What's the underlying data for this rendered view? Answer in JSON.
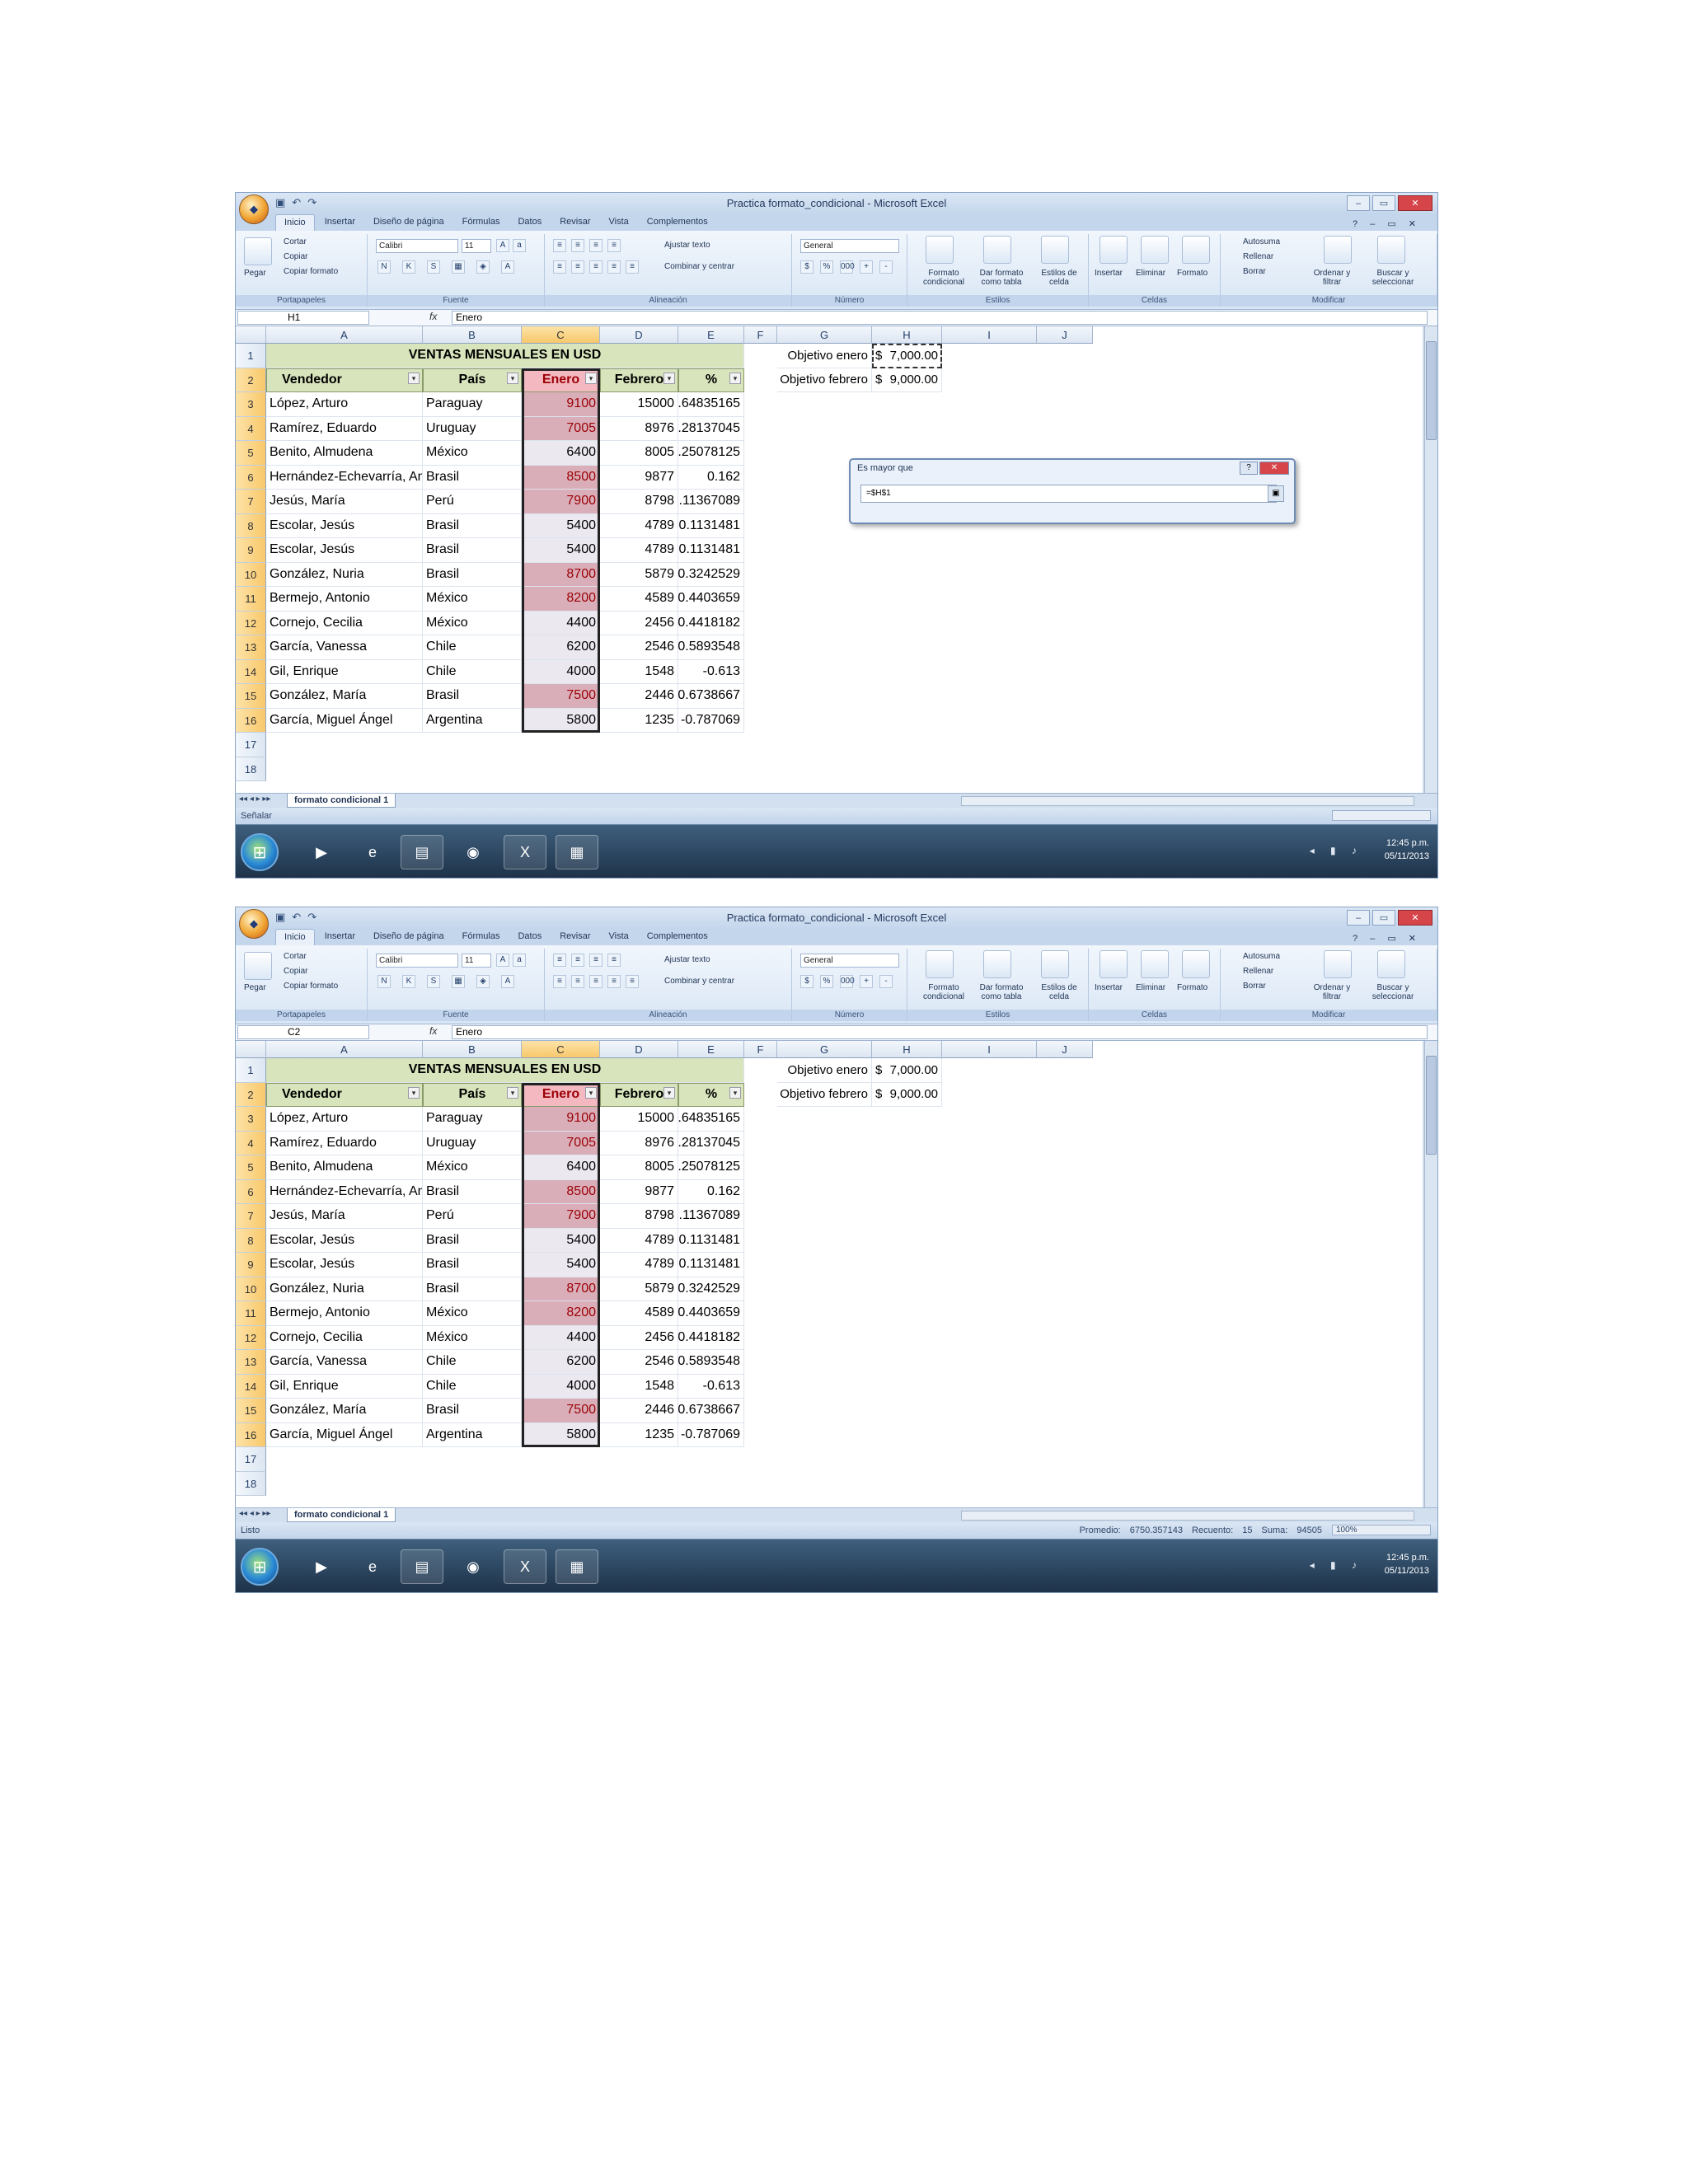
{
  "window_title": "Practica formato_condicional - Microsoft Excel",
  "ribbon_tabs": [
    "Inicio",
    "Insertar",
    "Diseño de página",
    "Fórmulas",
    "Datos",
    "Revisar",
    "Vista",
    "Complementos"
  ],
  "ribbon": {
    "paste": "Pegar",
    "cut": "Cortar",
    "copy": "Copiar",
    "format_painter": "Copiar formato",
    "group_clipboard": "Portapapeles",
    "font_name": "Calibri",
    "font_size": "11",
    "group_font": "Fuente",
    "wrap_text": "Ajustar texto",
    "merge_center": "Combinar y centrar",
    "group_alignment": "Alineación",
    "number_format": "General",
    "group_number": "Número",
    "conditional_format": "Formato condicional",
    "format_as_table": "Dar formato como tabla",
    "cell_styles": "Estilos de celda",
    "group_styles": "Estilos",
    "insert": "Insertar",
    "delete": "Eliminar",
    "format": "Formato",
    "group_cells": "Celdas",
    "autosum": "Autosuma",
    "fill": "Rellenar",
    "clear": "Borrar",
    "sort_filter": "Ordenar y filtrar",
    "find_select": "Buscar y seleccionar",
    "group_editing": "Modificar"
  },
  "columns": [
    "A",
    "B",
    "C",
    "D",
    "E",
    "F",
    "G",
    "H",
    "I",
    "J"
  ],
  "rows": [
    "1",
    "2",
    "3",
    "4",
    "5",
    "6",
    "7",
    "8",
    "9",
    "10",
    "11",
    "12",
    "13",
    "14",
    "15",
    "16",
    "17",
    "18"
  ],
  "table": {
    "title": "VENTAS MENSUALES EN USD",
    "headers": [
      "Vendedor",
      "País",
      "Enero",
      "Febrero",
      "%"
    ],
    "rows": [
      [
        "López, Arturo",
        "Paraguay",
        "9100",
        "15000",
        "0.64835165"
      ],
      [
        "Ramírez, Eduardo",
        "Uruguay",
        "7005",
        "8976",
        "0.28137045"
      ],
      [
        "Benito, Almudena",
        "México",
        "6400",
        "8005",
        "0.25078125"
      ],
      [
        "Hernández-Echevarría, Amaya",
        "Brasil",
        "8500",
        "9877",
        "0.162"
      ],
      [
        "Jesús, María",
        "Perú",
        "7900",
        "8798",
        "0.11367089"
      ],
      [
        "Escolar, Jesús",
        "Brasil",
        "5400",
        "4789",
        "-0.1131481"
      ],
      [
        "Escolar, Jesús",
        "Brasil",
        "5400",
        "4789",
        "-0.1131481"
      ],
      [
        "González, Nuria",
        "Brasil",
        "8700",
        "5879",
        "-0.3242529"
      ],
      [
        "Bermejo, Antonio",
        "México",
        "8200",
        "4589",
        "-0.4403659"
      ],
      [
        "Cornejo, Cecilia",
        "México",
        "4400",
        "2456",
        "-0.4418182"
      ],
      [
        "García, Vanessa",
        "Chile",
        "6200",
        "2546",
        "-0.5893548"
      ],
      [
        "Gil, Enrique",
        "Chile",
        "4000",
        "1548",
        "-0.613"
      ],
      [
        "González, María",
        "Brasil",
        "7500",
        "2446",
        "-0.6738667"
      ],
      [
        "García, Miguel Ángel",
        "Argentina",
        "5800",
        "1235",
        "-0.787069"
      ]
    ],
    "highlighted": [
      true,
      true,
      false,
      true,
      true,
      false,
      false,
      true,
      true,
      false,
      false,
      false,
      true,
      false
    ]
  },
  "objectives": {
    "enero_label": "Objetivo enero",
    "enero_currency": "$",
    "enero_value": "7,000.00",
    "febrero_label": "Objetivo febrero",
    "febrero_currency": "$",
    "febrero_value": "9,000.00"
  },
  "sheet_tab": "formato condicional 1",
  "colors": {
    "header_fill": "#d8e4bc",
    "highlight": "#d9aeb8",
    "highlight_text": "#9c0006",
    "normal_c": "#ebe8f0",
    "enero_header": "#f4b8c0"
  },
  "screens": [
    {
      "name_box": "H1",
      "formula": "Enero",
      "status_left": "Señalar",
      "status_right": "",
      "dialog": {
        "title": "Es mayor que",
        "input": "=$H$1"
      }
    },
    {
      "name_box": "C2",
      "formula": "Enero",
      "status_left": "Listo",
      "status_right": "Promedio: 6750.357143   Recuento: 15   Suma: 94505",
      "zoom": "100%"
    }
  ],
  "taskbar": {
    "clock_time": "12:45 p.m.",
    "clock_date": "05/11/2013"
  }
}
